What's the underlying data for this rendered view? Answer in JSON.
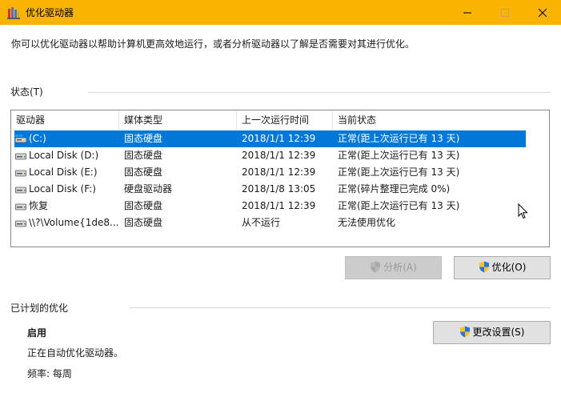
{
  "window": {
    "title": "优化驱动器"
  },
  "description": "你可以优化驱动器以帮助计算机更高效地运行，或者分析驱动器以了解是否需要对其进行优化。",
  "status_section": {
    "label": "状态(T)",
    "columns": [
      "驱动器",
      "媒体类型",
      "上一次运行时间",
      "当前状态"
    ],
    "drives": [
      {
        "name": "(C:)",
        "media": "固态硬盘",
        "last_run": "2018/1/1 12:39",
        "status": "正常(距上次运行已有 13 天)",
        "selected": true,
        "icon": "windows-drive-icon"
      },
      {
        "name": "Local Disk (D:)",
        "media": "固态硬盘",
        "last_run": "2018/1/1 12:39",
        "status": "正常(距上次运行已有 13 天)",
        "selected": false,
        "icon": "drive-icon"
      },
      {
        "name": "Local Disk (E:)",
        "media": "固态硬盘",
        "last_run": "2018/1/1 12:39",
        "status": "正常(距上次运行已有 13 天)",
        "selected": false,
        "icon": "drive-icon"
      },
      {
        "name": "Local Disk (F:)",
        "media": "硬盘驱动器",
        "last_run": "2018/1/8 13:05",
        "status": "正常(碎片整理已完成 0%)",
        "selected": false,
        "icon": "drive-icon"
      },
      {
        "name": "恢复",
        "media": "固态硬盘",
        "last_run": "2018/1/1 12:39",
        "status": "正常(距上次运行已有 13 天)",
        "selected": false,
        "icon": "drive-icon"
      },
      {
        "name": "\\\\?\\Volume{1de8...",
        "media": "固态硬盘",
        "last_run": "从不运行",
        "status": "无法使用优化",
        "selected": false,
        "icon": "drive-icon"
      }
    ]
  },
  "buttons": {
    "analyze": "分析(A)",
    "optimize": "优化(O)",
    "change_settings": "更改设置(S)"
  },
  "schedule_section": {
    "label": "已计划的优化",
    "enabled": "启用",
    "status_text": "正在自动优化驱动器。",
    "frequency": "频率: 每周"
  },
  "colors": {
    "titlebar": "#f8b400",
    "selection": "#0078d7"
  }
}
